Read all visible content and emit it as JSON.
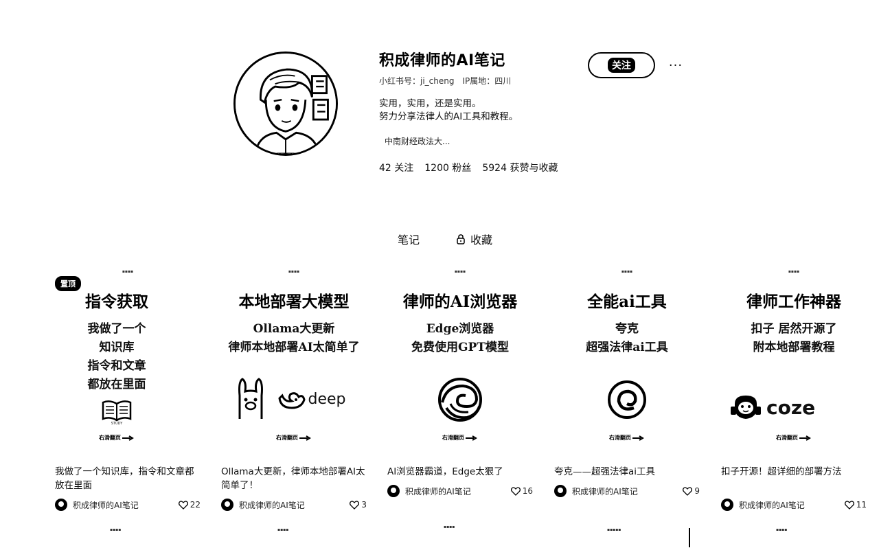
{
  "profile": {
    "name": "积成律师的AI笔记",
    "red_id": "小红书号：ji_cheng",
    "ip": "IP属地：四川",
    "bio_line1": "实用，实用，还是实用。",
    "bio_line2": "努力分享法律人的AI工具和教程。",
    "tag": "中南财经政法大...",
    "stats": {
      "following": "42 关注",
      "followers": "1200 粉丝",
      "likes": "5924 获赞与收藏"
    },
    "follow_label": "关注",
    "more_label": "···"
  },
  "tabs": {
    "notes": "笔记",
    "collections": "收藏"
  },
  "cards": [
    {
      "pin": "置顶",
      "cover_title": "指令获取",
      "cover_lines": [
        "我做了一个",
        "知识库",
        "指令和文章",
        "都放在里面"
      ],
      "logo_caption": "STUDY",
      "swipe": "右滑翻页",
      "title": "我做了一个知识库，指令和文章都放在里面",
      "author": "积成律师的AI笔记",
      "likes": "22"
    },
    {
      "cover_title": "本地部署大模型",
      "cover_lines": [
        "Ollama大更新",
        "律师本地部署AI太简单了"
      ],
      "logo_text": "deep",
      "swipe": "右滑翻页",
      "title": "Ollama大更新，律师本地部署AI太简单了！",
      "author": "积成律师的AI笔记",
      "likes": "3"
    },
    {
      "cover_title": "律师的AI浏览器",
      "cover_lines": [
        "Edge浏览器",
        "免费使用GPT模型"
      ],
      "swipe": "右滑翻页",
      "title": "AI浏览器霸道，Edge太狠了",
      "author": "积成律师的AI笔记",
      "likes": "16"
    },
    {
      "cover_title": "全能ai工具",
      "cover_lines": [
        "夸克",
        "超强法律ai工具"
      ],
      "swipe": "右滑翻页",
      "title": "夸克——超强法律ai工具",
      "author": "积成律师的AI笔记",
      "likes": "9"
    },
    {
      "cover_title": "律师工作神器",
      "cover_lines": [
        "扣子 居然开源了",
        "附本地部署教程"
      ],
      "logo_text": "coze",
      "swipe": "右滑翻页",
      "title": "扣子开源！超详细的部署方法",
      "author": "积成律师的AI笔记",
      "likes": "11"
    }
  ],
  "icons": {
    "lock": "lock-icon",
    "heart": "heart-icon",
    "arrow": "arrow-right-icon"
  }
}
